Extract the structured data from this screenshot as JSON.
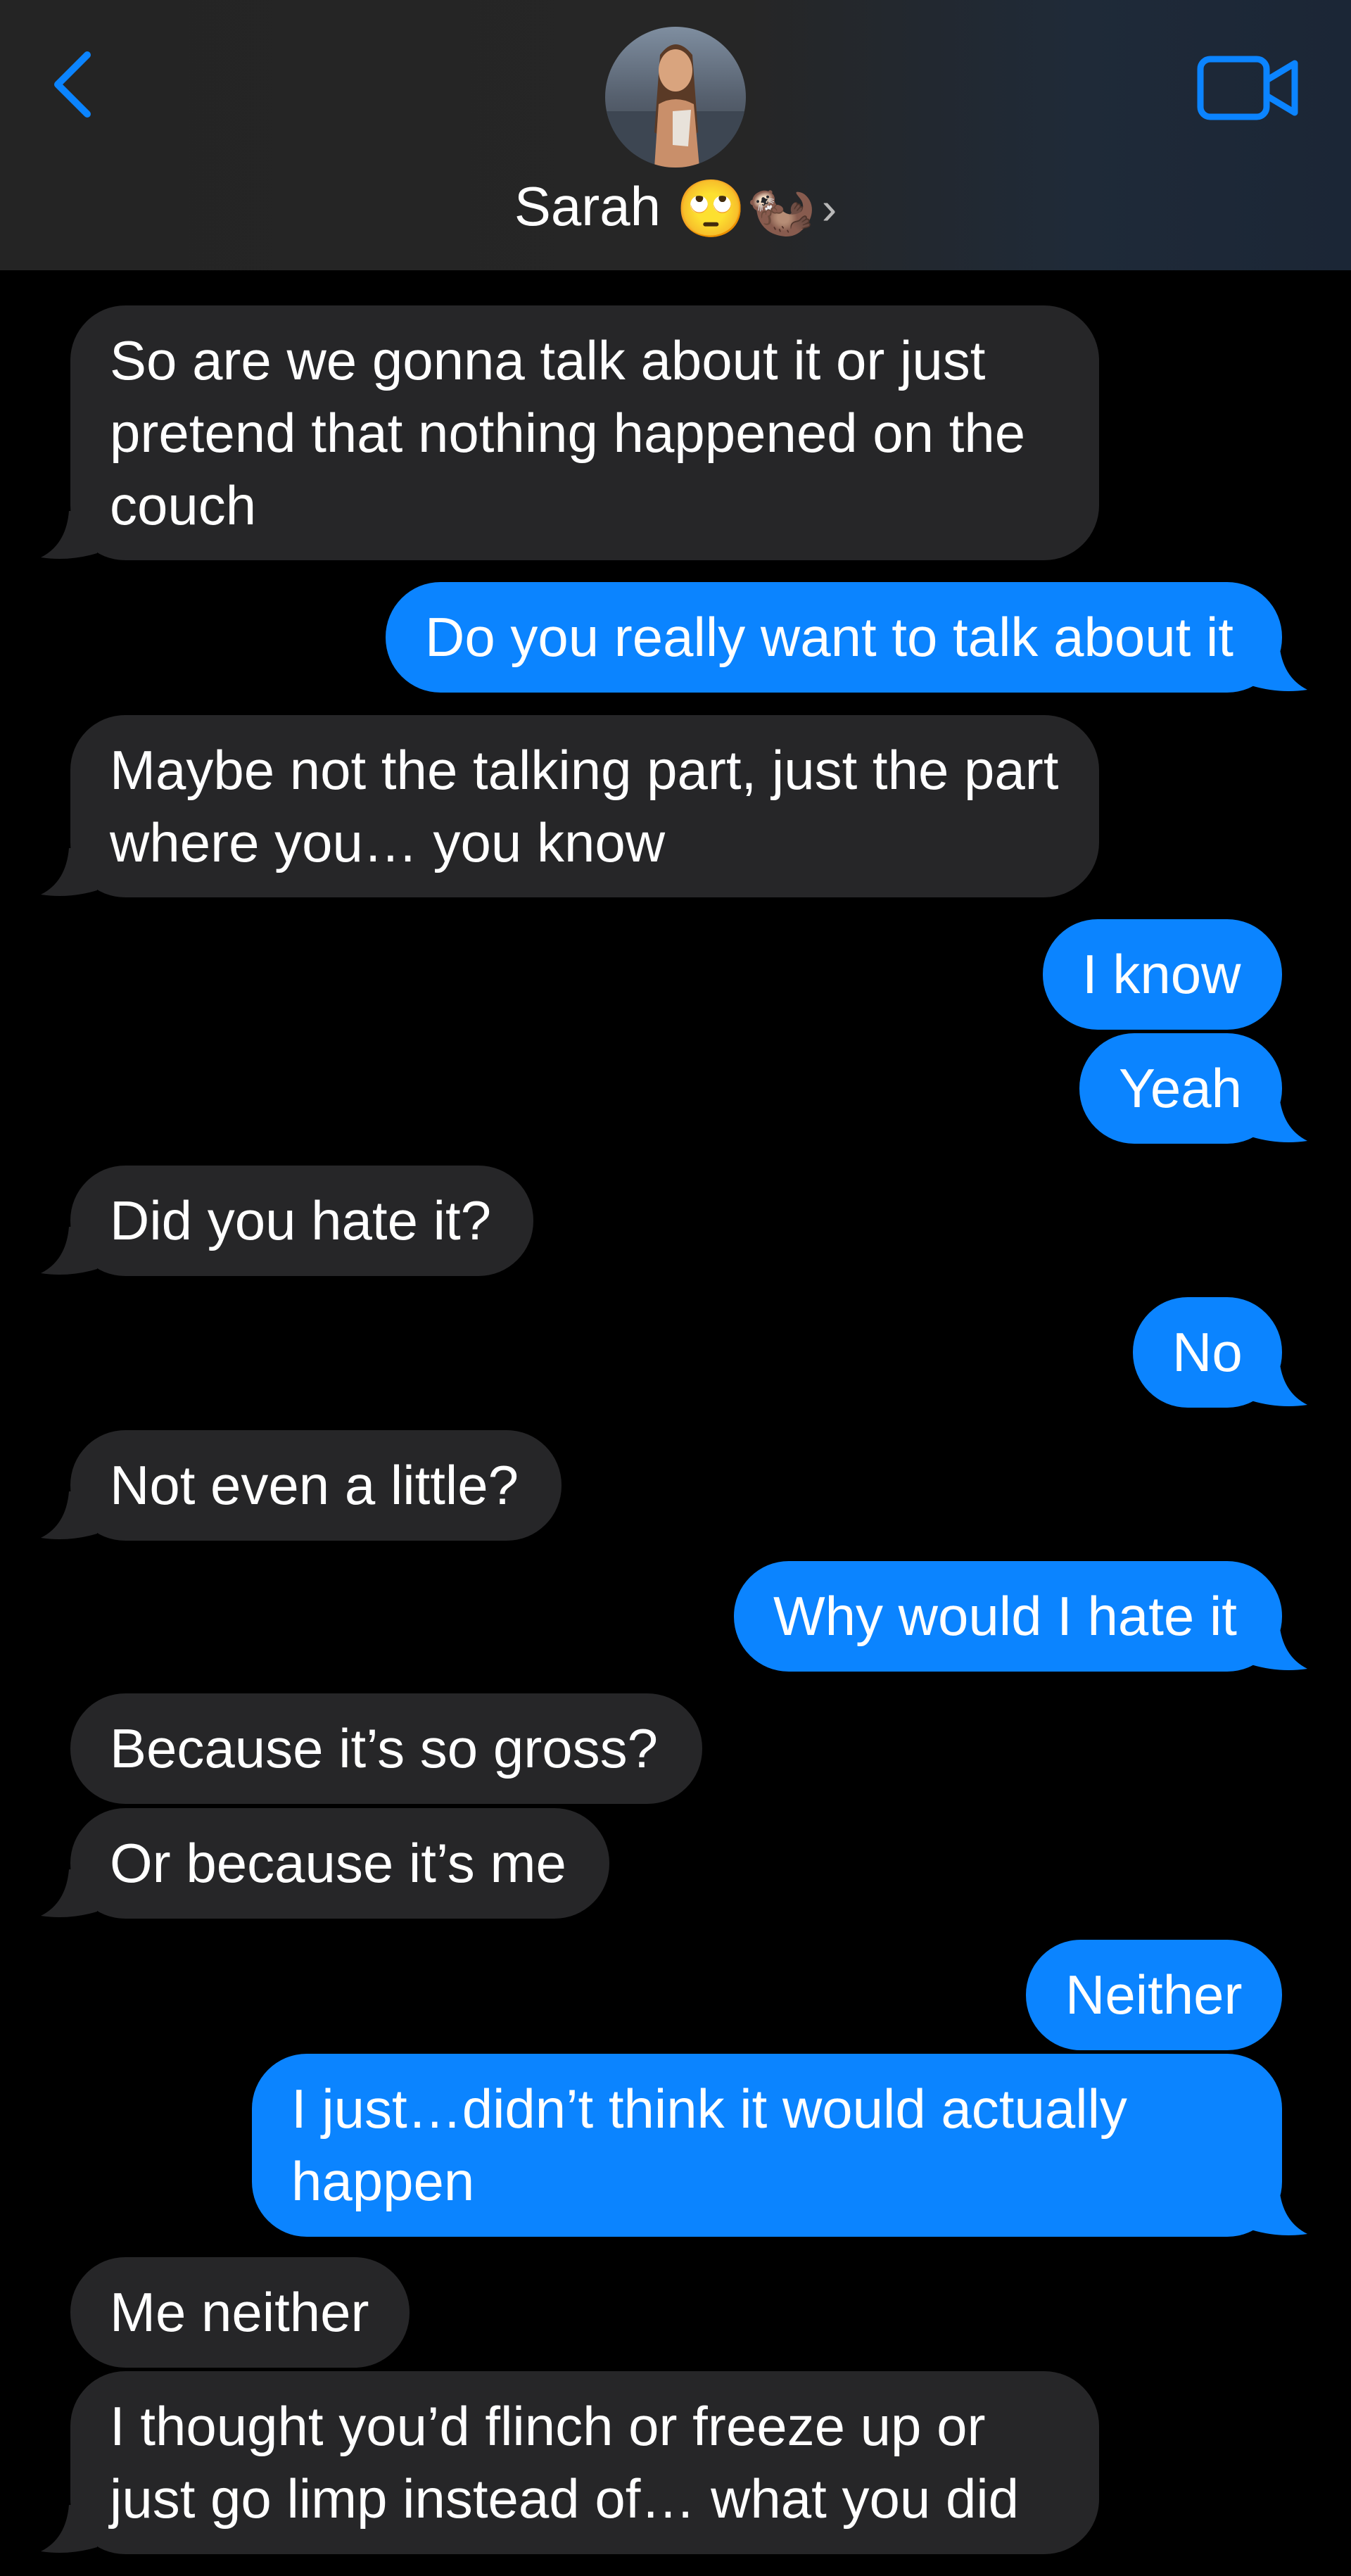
{
  "header": {
    "contact_name": "Sarah",
    "contact_emoji": "🙄🦦",
    "chevron": "›",
    "back_icon": "chevron-left-icon",
    "video_icon": "video-camera-icon",
    "accent_color": "#0b84ff"
  },
  "colors": {
    "incoming_bubble": "#262628",
    "outgoing_bubble": "#0b84ff",
    "background": "#000000"
  },
  "messages": [
    {
      "from": "them",
      "text": "So are we gonna talk about it or just pretend that nothing happened on the couch"
    },
    {
      "from": "me",
      "text": "Do you really want to talk about it"
    },
    {
      "from": "them",
      "text": "Maybe not the talking part, just the part where you… you know"
    },
    {
      "from": "me",
      "text": "I know"
    },
    {
      "from": "me",
      "text": "Yeah"
    },
    {
      "from": "them",
      "text": "Did you hate it?"
    },
    {
      "from": "me",
      "text": "No"
    },
    {
      "from": "them",
      "text": "Not even a little?"
    },
    {
      "from": "me",
      "text": "Why would I hate it"
    },
    {
      "from": "them",
      "text": "Because it’s so gross?"
    },
    {
      "from": "them",
      "text": "Or because it’s me"
    },
    {
      "from": "me",
      "text": "Neither"
    },
    {
      "from": "me",
      "text": "I just…didn’t think it would actually happen"
    },
    {
      "from": "them",
      "text": "Me neither"
    },
    {
      "from": "them",
      "text": "I thought you’d flinch or freeze up or just go limp instead of… what you did"
    }
  ]
}
